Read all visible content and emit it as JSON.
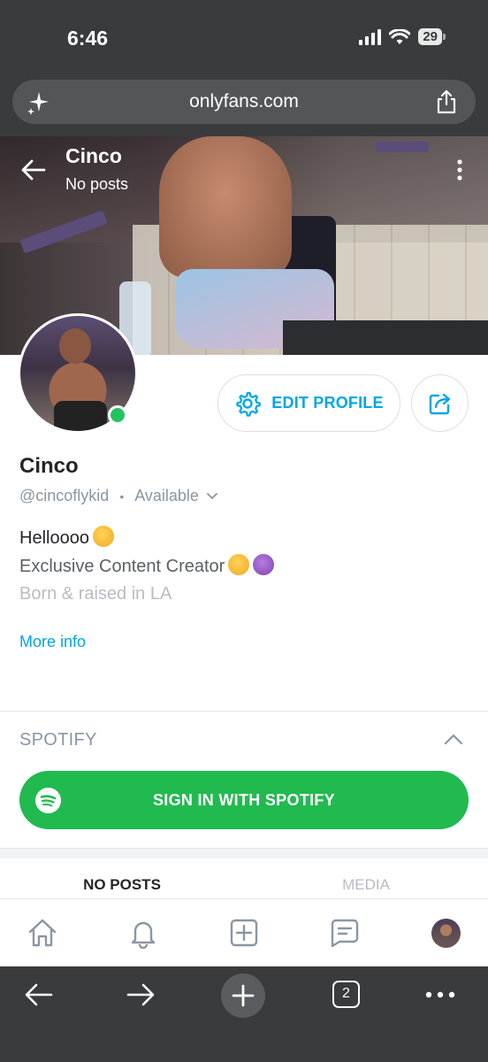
{
  "status_bar": {
    "time": "6:46",
    "battery": "29"
  },
  "browser": {
    "url": "onlyfans.com",
    "tabs_count": "2"
  },
  "cover": {
    "name": "Cinco",
    "subtitle": "No posts"
  },
  "profile": {
    "edit_label": "EDIT PROFILE",
    "name": "Cinco",
    "handle": "@cincoflykid",
    "separator": "•",
    "availability": "Available",
    "bio_line1": "Helloooo",
    "bio_line2": "Exclusive Content Creator",
    "bio_line3": "Born & raised in LA",
    "more_info": "More info"
  },
  "spotify": {
    "label": "SPOTIFY",
    "button": "SIGN IN WITH SPOTIFY"
  },
  "tabs": [
    {
      "label": "NO POSTS",
      "active": true
    },
    {
      "label": "MEDIA",
      "active": false
    }
  ],
  "colors": {
    "accent": "#00a7e4",
    "spotify_green": "#21ba4f",
    "online": "#21c45d"
  },
  "icons": [
    "sparkle-icon",
    "share-icon",
    "back-arrow-icon",
    "more-vertical-icon",
    "settings-gear-icon",
    "share-box-icon",
    "chevron-down-icon",
    "chevron-up-icon",
    "spotify-logo-icon",
    "home-icon",
    "bell-icon",
    "add-post-icon",
    "messages-icon",
    "forward-arrow-icon",
    "plus-icon",
    "ellipsis-icon"
  ]
}
